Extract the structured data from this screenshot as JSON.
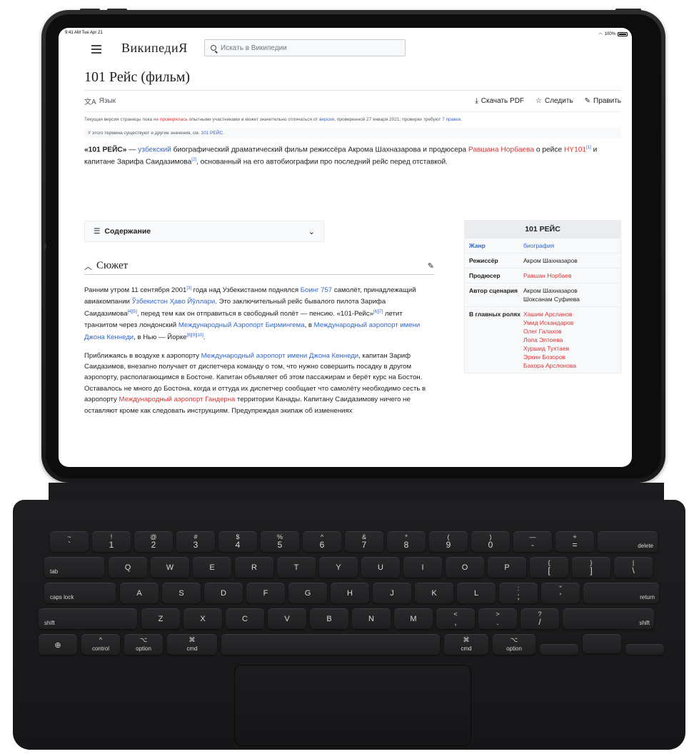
{
  "status": {
    "time": "9:41 AM",
    "date": "Tue Apr 21",
    "battery": "100%"
  },
  "header": {
    "logo": "ВикипедиЯ",
    "search_placeholder": "Искать в Википедии"
  },
  "page": {
    "title": "101 Рейс (фильм)",
    "language": "Язык",
    "download_pdf": "Скачать PDF",
    "watch": "Следить",
    "edit": "Править"
  },
  "notice": {
    "p1": "Текущая версия страницы пока ",
    "link1": "не проверялась",
    "p2": " опытными участниками и может значительно отличаться от ",
    "link2": "версии",
    "p3": ", проверенной 27 января 2021; проверки требуют ",
    "link3": "7 правок",
    "p4": "."
  },
  "hatnote": {
    "text": "У этого термина существуют и другие значения, см. ",
    "link": "101 РЕЙС",
    "end": "."
  },
  "lead": {
    "bold": "«101 РЕЙС»",
    "t1": " — ",
    "link1": "узбекский",
    "t2": " биографический драматический фильм режиссёра Акрома Шахназарова и продюсера ",
    "link2": "Равшана Норбаева",
    "t3": " о рейсе ",
    "link3": "HY101",
    "sup1": "[1]",
    "t4": " и капитане Зарифа Саидазимова",
    "sup2": "[2]",
    "t5": ", основанный на его автобиографии про последний рейс перед отставкой."
  },
  "toc": {
    "label": "Содержание"
  },
  "section": {
    "title": "Сюжет"
  },
  "para1": {
    "t1": "Ранним утром 11 сентября 2001",
    "s1": "[3]",
    "t2": " года над Узбекистаном поднялся ",
    "l1": "Боинг 757",
    "t3": " самолёт, принадлежащий авиакомпании ",
    "l2": "Ўзбекистон Ҳаво Йўллари",
    "t4": ". Это заключительный рейс бывалого пилота Зарифа Саидазимова",
    "s2": "[4][5]",
    "t5": ", перед тем как он отправиться в свободный полёт — пенсию. «101-Рейс»",
    "s3": "[6][7]",
    "t6": " летит транзитом через лондонский ",
    "l3": "Международный Аэропорт Бирмингема",
    "t7": ", в ",
    "l4": "Международный аэропорт имени Джона Кеннеди",
    "t8": ", в Нью — Йорке",
    "s4": "[8][9][10]",
    "t9": "."
  },
  "para2": {
    "t1": "Приближаясь в воздухе к аэропорту ",
    "l1": "Международный аэропорт имени Джона Кеннеди",
    "t2": ", капитан Зариф Саидазимов, внезапно получает от диспетчера команду о том, что нужно совершить посадку в другом аэропорту, располагающимся в Бостоне. Капитан объявляет об этом пассажирам и берёт курс на Бостон. Оставалось не много до Бостона, когда и оттуда их диспетчер сообщает что самолёту необходимо сесть в аэропорту ",
    "l2": "Международный аэропорт Гандерна",
    "t3": " территории Канады. Капитану Саидазимову ничего не оставляют кроме как следовать инструкциям. Предупреждая экипаж об изменениях"
  },
  "infobox": {
    "title": "101 РЕЙС",
    "genre_k": "Жанр",
    "genre_v": "биография",
    "director_k": "Режиссёр",
    "director_v": "Акром Шахназаров",
    "producer_k": "Продюсер",
    "producer_v": "Равшан Норбаев",
    "writer_k": "Автор сценария",
    "writer_v1": "Акром Шахназаров",
    "writer_v2": "Шоксанам Суфиева",
    "cast_k": "В главных ролях",
    "cast": [
      "Хашим Арсланов",
      "Умид Искандаров",
      "Олег Галахов",
      "Лола Элтоева",
      "Хуршид Тухтаев",
      "Эркин Бозоров",
      "Бахора Арслонова"
    ]
  },
  "keyboard": {
    "row1": [
      [
        "~",
        "`"
      ],
      [
        "!",
        "1"
      ],
      [
        "@",
        "2"
      ],
      [
        "#",
        "3"
      ],
      [
        "$",
        "4"
      ],
      [
        "%",
        "5"
      ],
      [
        "^",
        "6"
      ],
      [
        "&",
        "7"
      ],
      [
        "*",
        "8"
      ],
      [
        "(",
        "9"
      ],
      [
        ")",
        "0"
      ],
      [
        "—",
        "-"
      ],
      [
        "+",
        "="
      ]
    ],
    "delete": "delete",
    "tab": "tab",
    "row2": [
      "Q",
      "W",
      "E",
      "R",
      "T",
      "Y",
      "U",
      "I",
      "O",
      "P"
    ],
    "row2p": [
      [
        "{",
        "["
      ],
      [
        "}",
        "]"
      ],
      [
        "|",
        "\\"
      ]
    ],
    "caps": "caps lock",
    "row3": [
      "A",
      "S",
      "D",
      "F",
      "G",
      "H",
      "J",
      "K",
      "L"
    ],
    "row3p": [
      [
        ":",
        ";"
      ],
      [
        "\"",
        "'"
      ]
    ],
    "return": "return",
    "shift": "shift",
    "row4": [
      "Z",
      "X",
      "C",
      "V",
      "B",
      "N",
      "M"
    ],
    "row4p": [
      [
        "<",
        ","
      ],
      [
        ">",
        "."
      ],
      [
        "?",
        "/"
      ]
    ],
    "control": "control",
    "option": "option",
    "cmd": "cmd",
    "ctrl_sym": "^",
    "opt_sym": "⌥",
    "cmd_sym": "⌘"
  }
}
